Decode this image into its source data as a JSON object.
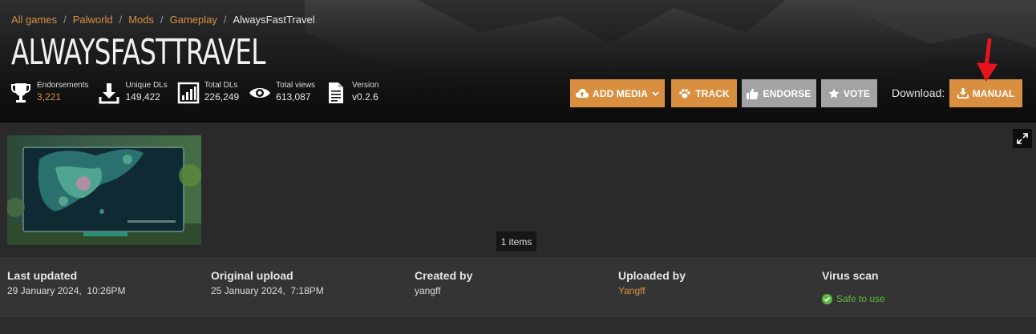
{
  "breadcrumb": {
    "items": [
      "All games",
      "Palworld",
      "Mods",
      "Gameplay"
    ],
    "current": "AlwaysFastTravel"
  },
  "title": "ALWAYSFASTTRAVEL",
  "stats": [
    {
      "label": "Endorsements",
      "value": "3,221",
      "icon": "trophy-icon"
    },
    {
      "label": "Unique DLs",
      "value": "149,422",
      "icon": "download-icon"
    },
    {
      "label": "Total DLs",
      "value": "226,249",
      "icon": "bar-chart-icon"
    },
    {
      "label": "Total views",
      "value": "613,087",
      "icon": "eye-icon"
    },
    {
      "label": "Version",
      "value": "v0.2.6",
      "icon": "document-icon"
    }
  ],
  "actions": {
    "add_media": "ADD MEDIA",
    "track": "TRACK",
    "endorse": "ENDORSE",
    "vote": "VOTE",
    "download_label": "Download:",
    "manual": "MANUAL"
  },
  "gallery": {
    "count_label": "1 items"
  },
  "meta": {
    "last_updated": {
      "label": "Last updated",
      "value": "29 January 2024,  10:26PM"
    },
    "original_upload": {
      "label": "Original upload",
      "value": "25 January 2024,  7:18PM"
    },
    "created_by": {
      "label": "Created by",
      "value": "yangff"
    },
    "uploaded_by": {
      "label": "Uploaded by",
      "value": "Yangff"
    },
    "virus_scan": {
      "label": "Virus scan",
      "value": "Safe to use"
    }
  },
  "colors": {
    "accent": "#d98f40",
    "grey_button": "#a3a3a3",
    "safe": "#5dbb3f",
    "annotation_arrow": "#e8141c"
  }
}
